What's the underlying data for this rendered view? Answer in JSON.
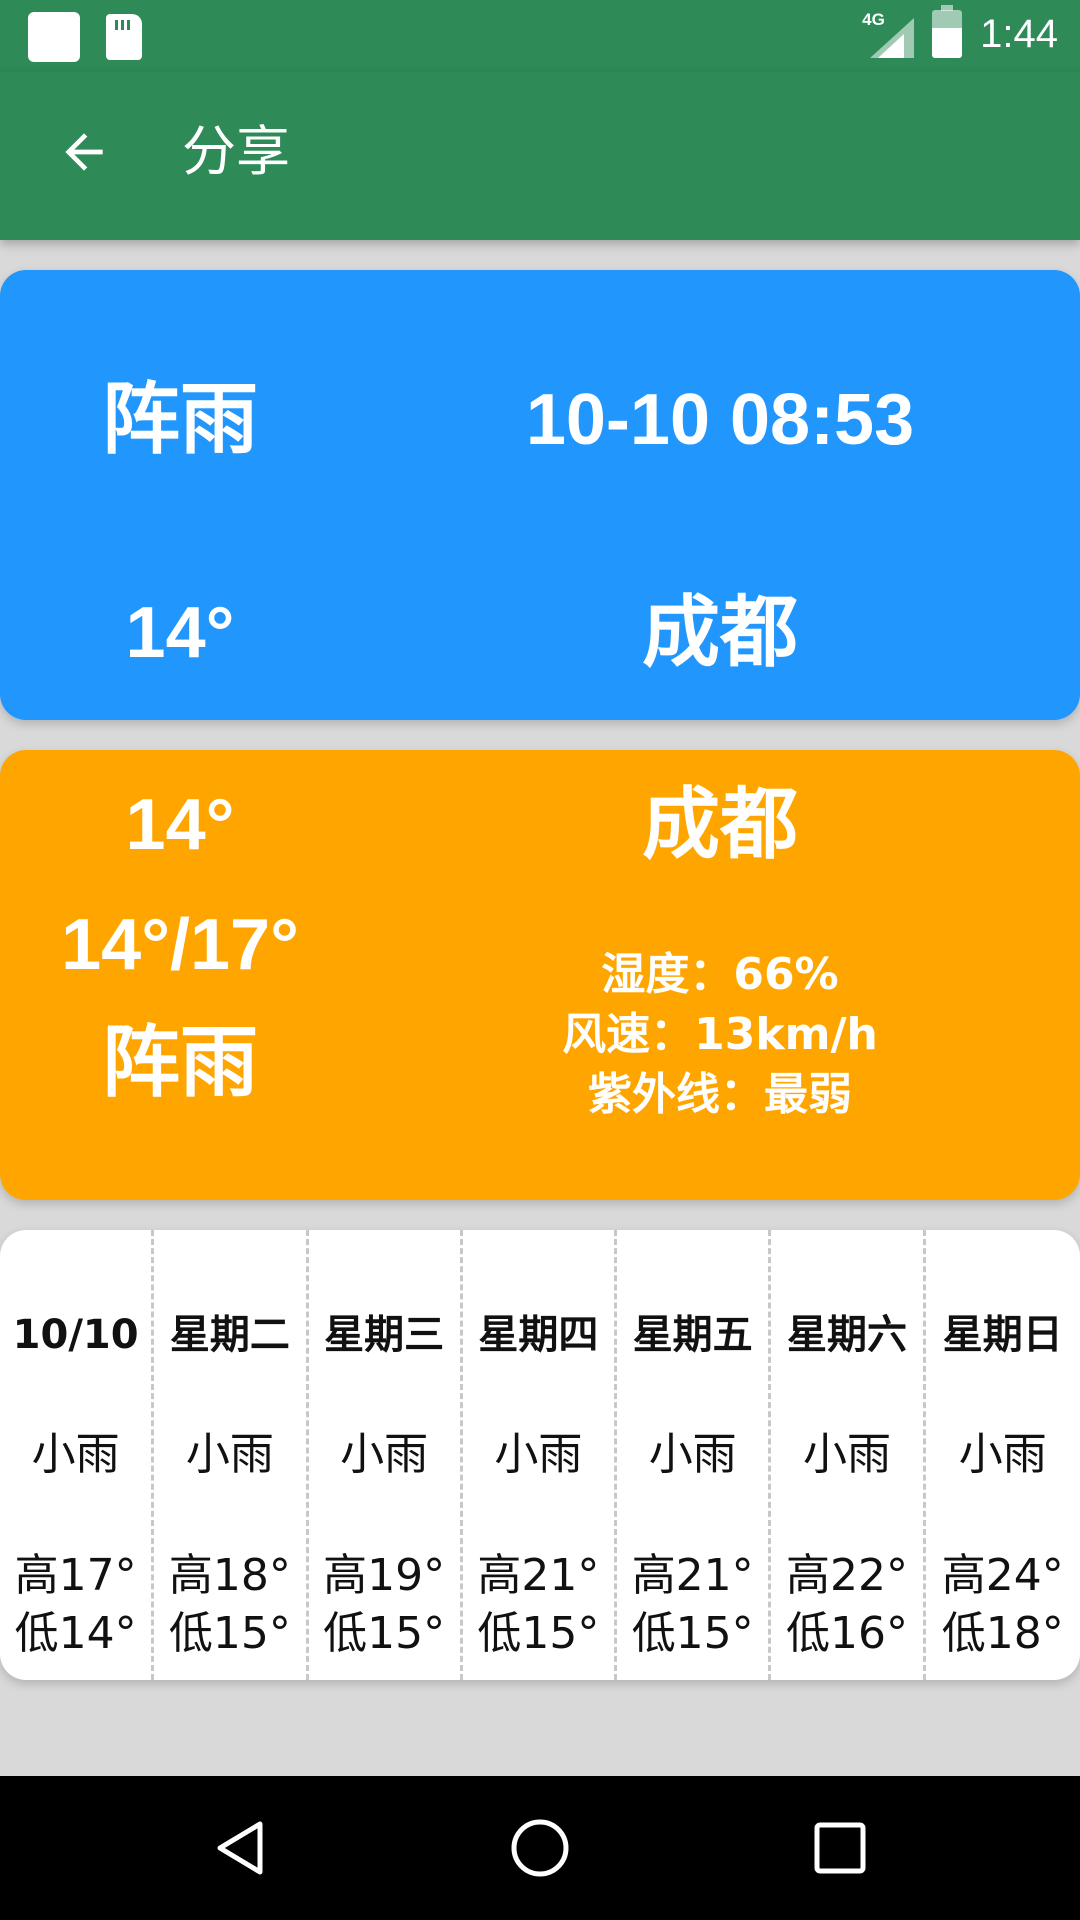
{
  "status_bar": {
    "network": "4G",
    "time": "1:44"
  },
  "app_bar": {
    "title": "分享",
    "back_icon": "arrow-left-icon"
  },
  "current_card": {
    "condition": "阵雨",
    "datetime": "10-10 08:53",
    "temperature": "14°",
    "city": "成都",
    "color": "#2196FD"
  },
  "detail_card": {
    "temperature": "14°",
    "range": "14°/17°",
    "condition": "阵雨",
    "city": "成都",
    "humidity": "湿度：66%",
    "wind": "风速：13km/h",
    "uv": "紫外线：最弱",
    "color": "#FFA500"
  },
  "forecast": [
    {
      "label": "10/10",
      "condition": "小雨",
      "high": "高17°",
      "low": "低14°"
    },
    {
      "label": "星期二",
      "condition": "小雨",
      "high": "高18°",
      "low": "低15°"
    },
    {
      "label": "星期三",
      "condition": "小雨",
      "high": "高19°",
      "low": "低15°"
    },
    {
      "label": "星期四",
      "condition": "小雨",
      "high": "高21°",
      "low": "低15°"
    },
    {
      "label": "星期五",
      "condition": "小雨",
      "high": "高21°",
      "low": "低15°"
    },
    {
      "label": "星期六",
      "condition": "小雨",
      "high": "高22°",
      "low": "低16°"
    },
    {
      "label": "星期日",
      "condition": "小雨",
      "high": "高24°",
      "low": "低18°"
    }
  ],
  "nav_bar": {
    "back_icon": "triangle-back-icon",
    "home_icon": "circle-home-icon",
    "recents_icon": "square-recents-icon"
  },
  "colors": {
    "primary": "#2E8B57",
    "background": "#D9D9D9"
  }
}
